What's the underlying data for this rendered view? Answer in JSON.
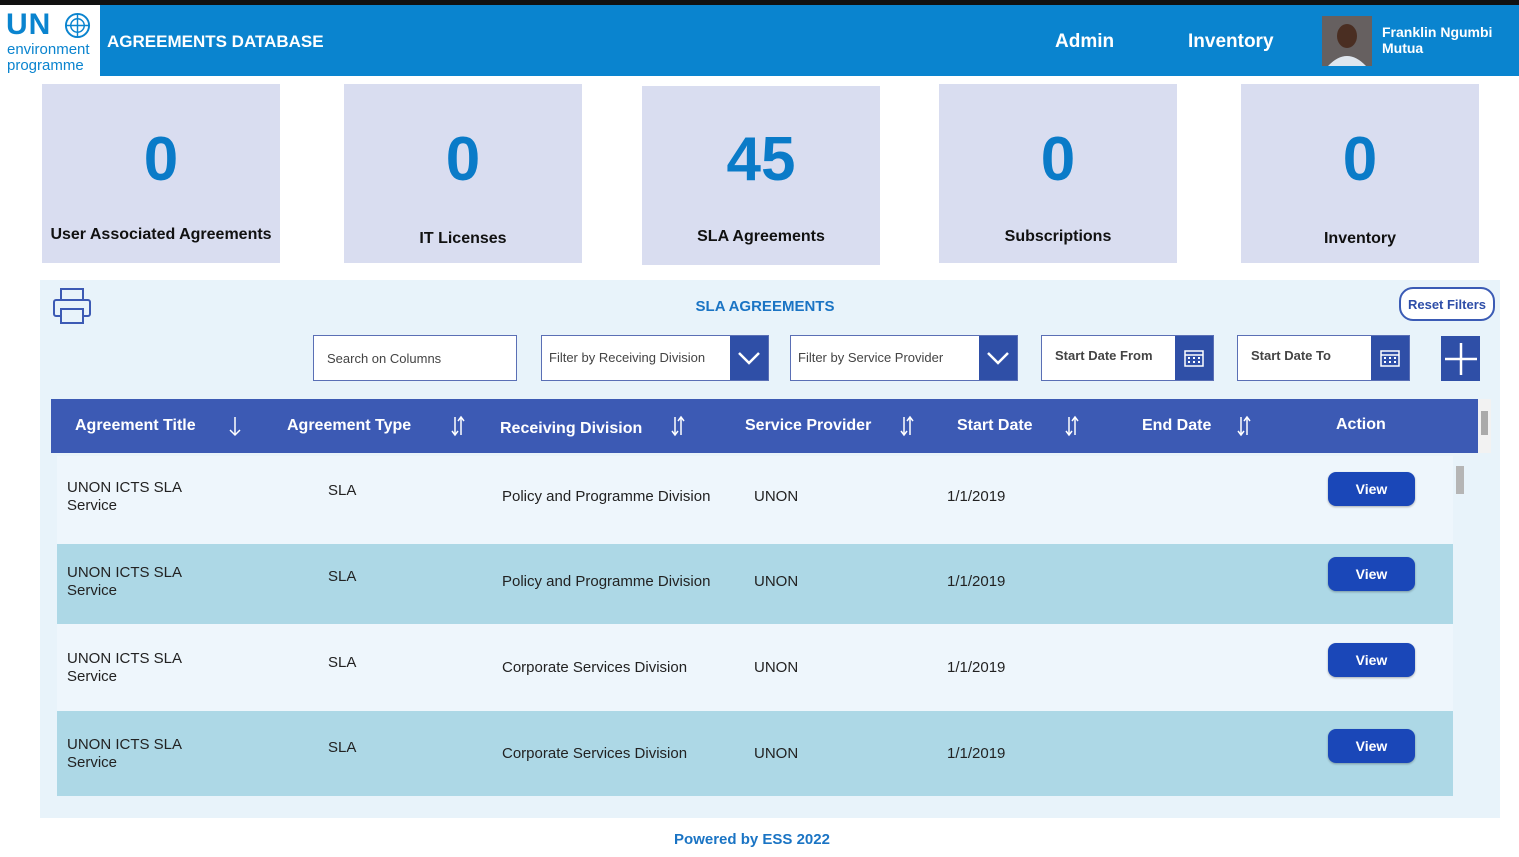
{
  "header": {
    "logo_un": "UN",
    "logo_line1": "environment",
    "logo_line2": "programme",
    "app_title": "AGREEMENTS DATABASE",
    "nav": [
      "Admin",
      "Inventory"
    ],
    "user_name": "Franklin Ngumbi Mutua"
  },
  "tiles": [
    {
      "value": "0",
      "label": "User Associated Agreements"
    },
    {
      "value": "0",
      "label": "IT Licenses"
    },
    {
      "value": "45",
      "label": "SLA Agreements"
    },
    {
      "value": "0",
      "label": "Subscriptions"
    },
    {
      "value": "0",
      "label": "Inventory"
    }
  ],
  "panel": {
    "title": "SLA AGREEMENTS",
    "reset_label": "Reset Filters",
    "search_placeholder": "Search on Columns",
    "filter_division": "Filter by Receiving Division",
    "filter_provider": "Filter by Service Provider",
    "start_from": "Start Date From",
    "start_to": "Start Date To"
  },
  "table": {
    "columns": [
      "Agreement Title",
      "Agreement Type",
      "Receiving Division",
      "Service Provider",
      "Start Date",
      "End Date",
      "Action"
    ],
    "rows": [
      {
        "title1": "UNON ICTS SLA",
        "title2": "Service",
        "type": "SLA",
        "division": "Policy and Programme Division",
        "provider": "UNON",
        "start": "1/1/2019",
        "end": "",
        "action": "View"
      },
      {
        "title1": "UNON ICTS SLA",
        "title2": "Service",
        "type": "SLA",
        "division": "Policy and Programme Division",
        "provider": "UNON",
        "start": "1/1/2019",
        "end": "",
        "action": "View"
      },
      {
        "title1": "UNON ICTS SLA",
        "title2": "Service",
        "type": "SLA",
        "division": "Corporate Services Division",
        "provider": "UNON",
        "start": "1/1/2019",
        "end": "",
        "action": "View"
      },
      {
        "title1": "UNON ICTS SLA",
        "title2": "Service",
        "type": "SLA",
        "division": "Corporate Services Division",
        "provider": "UNON",
        "start": "1/1/2019",
        "end": "",
        "action": "View"
      }
    ]
  },
  "footer": "Powered by ESS  2022",
  "colors": {
    "header": "#0a84cf",
    "tile": "#d9ddf0",
    "table_header": "#3c5ab4",
    "row_alt": "#add8e6",
    "row": "#eef6fc",
    "button": "#1a47b8"
  }
}
